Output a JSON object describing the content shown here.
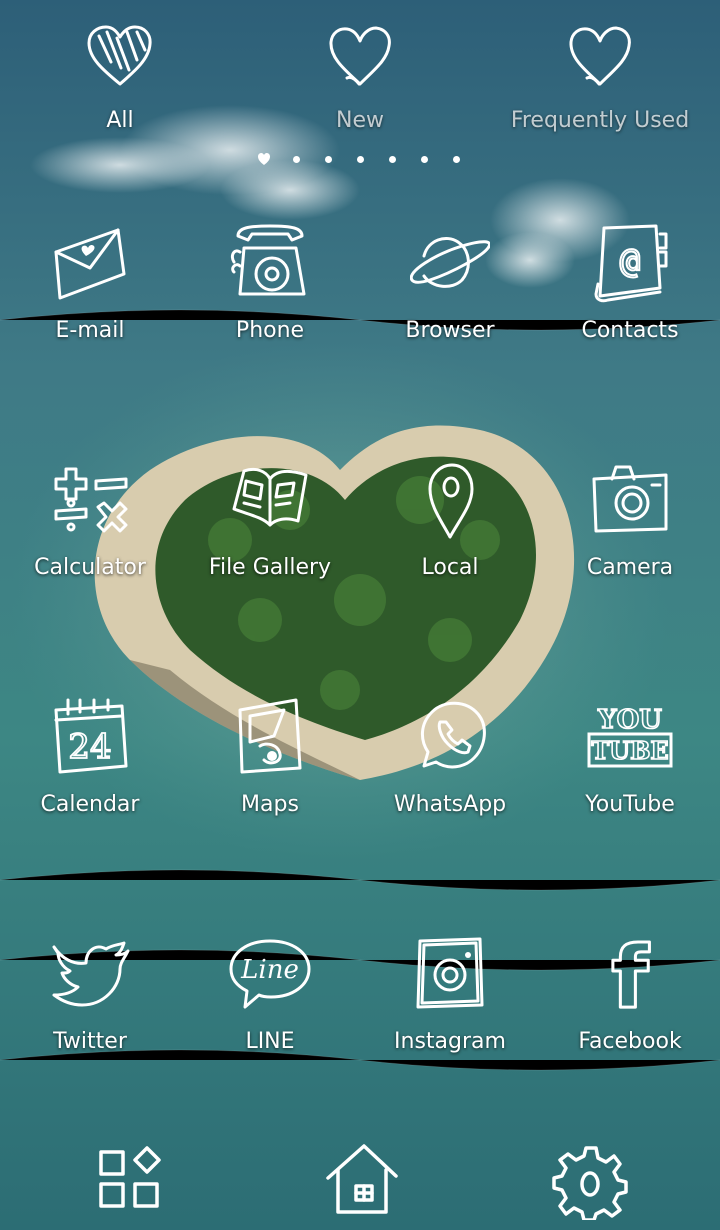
{
  "tabs": [
    {
      "label": "All",
      "icon": "filled-heart-icon"
    },
    {
      "label": "New",
      "icon": "heart-outline-icon"
    },
    {
      "label": "Frequently Used",
      "icon": "heart-outline-icon"
    }
  ],
  "pager": {
    "page_count": 7,
    "current_page": 1,
    "current_indicator": "heart"
  },
  "apps": [
    {
      "label": "E-mail",
      "icon": "envelope-icon"
    },
    {
      "label": "Phone",
      "icon": "rotary-phone-icon"
    },
    {
      "label": "Browser",
      "icon": "planet-icon"
    },
    {
      "label": "Contacts",
      "icon": "address-book-icon"
    },
    {
      "label": "Calculator",
      "icon": "calculator-symbols-icon"
    },
    {
      "label": "File Gallery",
      "icon": "open-book-icon"
    },
    {
      "label": "Local",
      "icon": "map-pin-icon"
    },
    {
      "label": "Camera",
      "icon": "camera-icon"
    },
    {
      "label": "Calendar",
      "icon": "calendar-icon"
    },
    {
      "label": "Maps",
      "icon": "folded-map-icon"
    },
    {
      "label": "WhatsApp",
      "icon": "whatsapp-icon"
    },
    {
      "label": "YouTube",
      "icon": "youtube-icon"
    },
    {
      "label": "Twitter",
      "icon": "bird-icon"
    },
    {
      "label": "LINE",
      "icon": "line-bubble-icon"
    },
    {
      "label": "Instagram",
      "icon": "instagram-icon"
    },
    {
      "label": "Facebook",
      "icon": "facebook-icon"
    }
  ],
  "calendar_icon_day": "24",
  "youtube_icon_text": {
    "top": "YOU",
    "bottom": "TUBE"
  },
  "line_icon_text": "Line",
  "contacts_icon_symbol": "@",
  "facebook_icon_letter": "f",
  "dock": [
    {
      "icon": "app-grid-icon"
    },
    {
      "icon": "home-icon"
    },
    {
      "icon": "gear-icon"
    }
  ],
  "colors": {
    "icon_stroke": "#ffffff",
    "sea": "#2b6b78",
    "label_text": "#ffffff"
  }
}
